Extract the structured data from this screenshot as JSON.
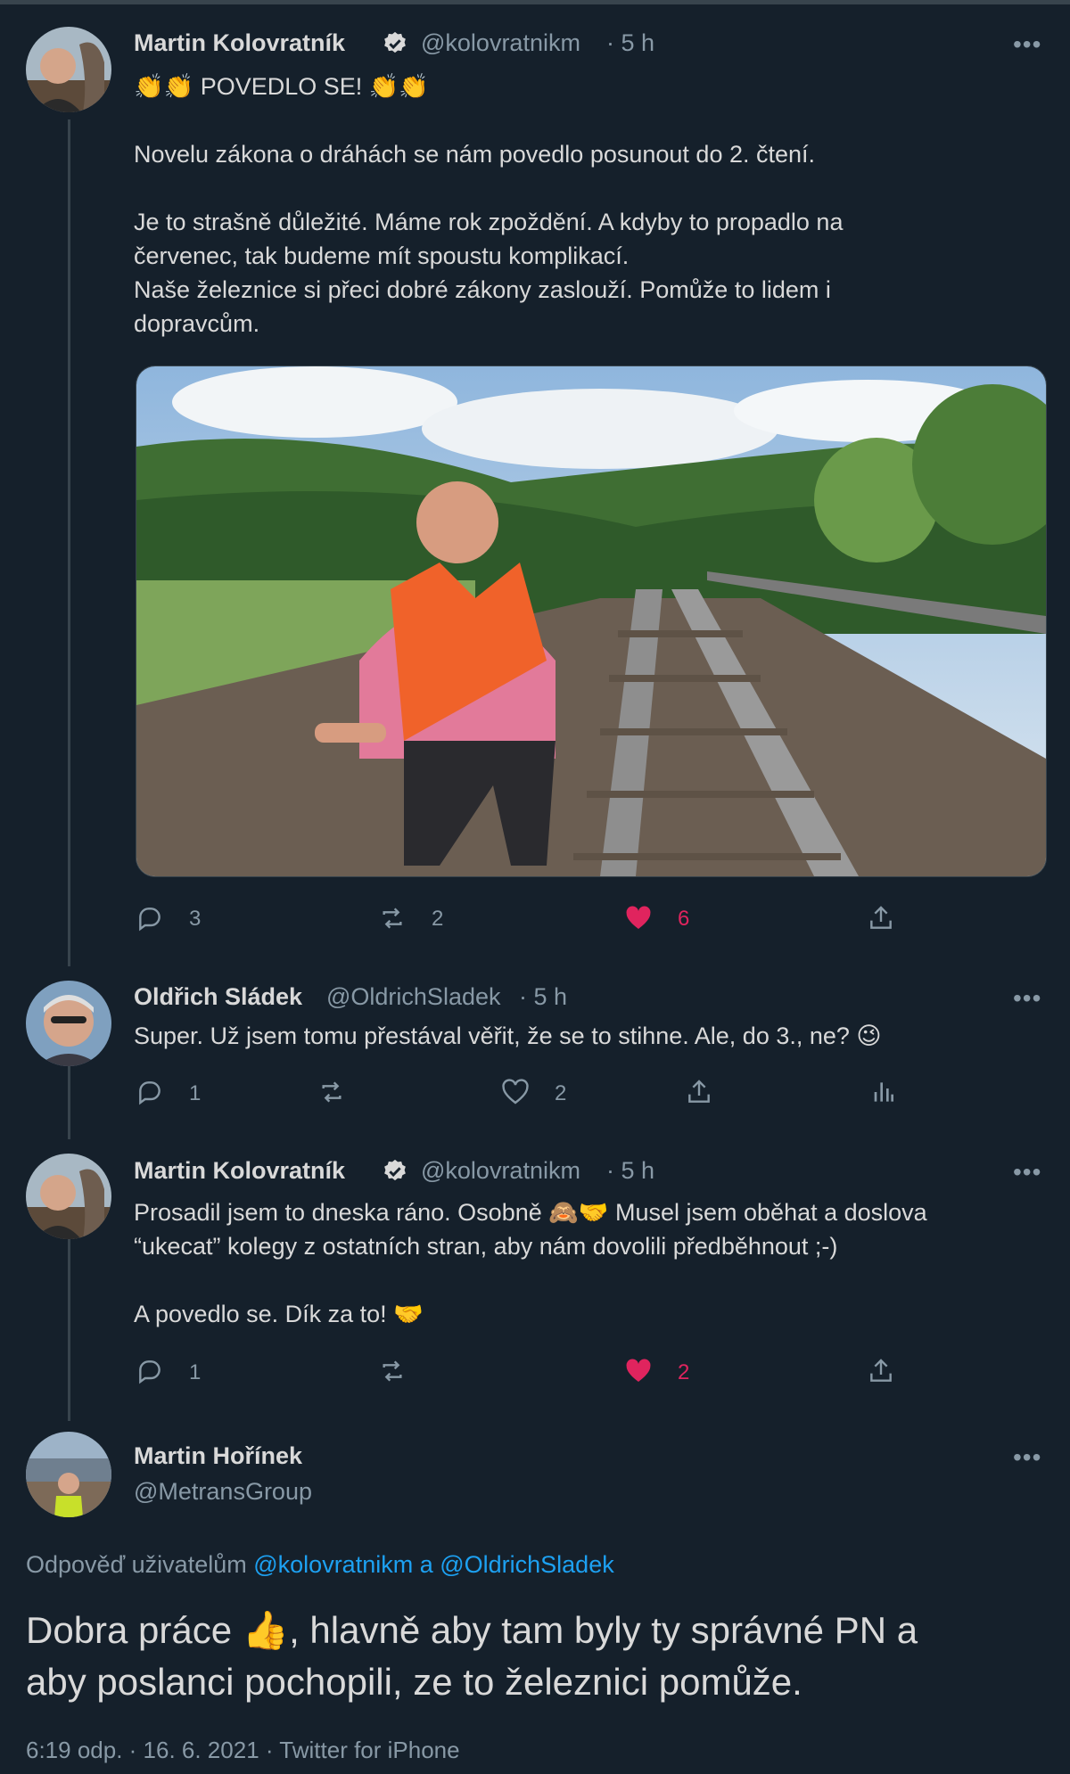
{
  "tweets": [
    {
      "author": "Martin Kolovratník",
      "handle": "@kolovratnikm",
      "time": "· 5 h",
      "verified": true,
      "text_line1": "👏👏 POVEDLO SE! 👏👏",
      "text_body": "Novelu zákona o dráhách se nám povedlo posunout do 2. čtení.\n\nJe to strašně důležité. Máme rok zpoždění. A kdyby to propadlo na\nčervenec, tak budeme mít spoustu komplikací.\nNaše železnice si přeci dobré zákony zaslouží. Pomůže to lidem i\ndopravcům.",
      "replies": "3",
      "retweets": "2",
      "likes": "6"
    },
    {
      "author": "Oldřich Sládek",
      "handle": "@OldrichSladek",
      "time": "· 5 h",
      "text": "Super. Už jsem tomu přestával věřit, že se to stihne. Ale, do 3., ne? 😉",
      "replies": "1",
      "retweets": "",
      "likes": "2"
    },
    {
      "author": "Martin Kolovratník",
      "handle": "@kolovratnikm",
      "time": "· 5 h",
      "verified": true,
      "text": "Prosadil jsem to dneska ráno. Osobně 🙈🤝 Musel jsem oběhat a doslova\n“ukecat” kolegy z ostatních stran, aby nám dovolili předběhnout ;-)\n\nA povedlo se. Dík za to! 🤝",
      "replies": "1",
      "retweets": "",
      "likes": "2"
    }
  ],
  "main": {
    "author": "Martin Hořínek",
    "handle": "@MetransGroup",
    "reply_prefix": "Odpověď uživatelům",
    "reply_to": "@kolovratnikm a @OldrichSladek",
    "text": "Dobra práce 👍, hlavně aby tam byly ty správné PN a\naby poslanci pochopili, ze to železnici pomůže.",
    "timestamp": "6:19 odp. · 16. 6. 2021 · Twitter for iPhone"
  },
  "more_label": "•••",
  "colors": {
    "background": "#15202b",
    "like": "#e0245e",
    "link": "#1da1f2",
    "muted": "#8899a6"
  }
}
